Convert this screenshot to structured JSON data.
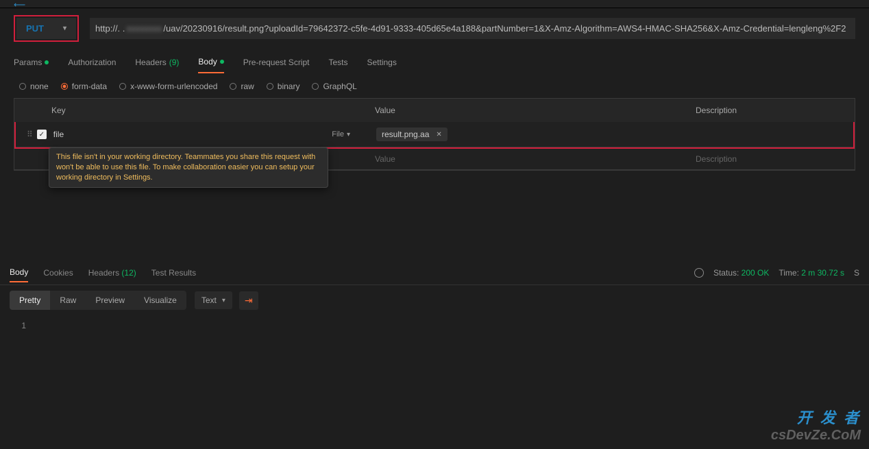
{
  "request": {
    "method": "PUT",
    "url_prefix": "http://. .",
    "url_blur": "xxxxxxxx",
    "url_rest": "/uav/20230916/result.png?uploadId=79642372-c5fe-4d91-9333-405d65e4a188&partNumber=1&X-Amz-Algorithm=AWS4-HMAC-SHA256&X-Amz-Credential=lengleng%2F2"
  },
  "tabs": {
    "params": "Params",
    "authorization": "Authorization",
    "headers": "Headers",
    "headers_count": "(9)",
    "body": "Body",
    "prerequest": "Pre-request Script",
    "tests": "Tests",
    "settings": "Settings"
  },
  "body_types": {
    "none": "none",
    "form": "form-data",
    "urlenc": "x-www-form-urlencoded",
    "raw": "raw",
    "binary": "binary",
    "graphql": "GraphQL"
  },
  "table": {
    "hkey": "Key",
    "hval": "Value",
    "hdesc": "Description",
    "row1_key": "file",
    "row1_type": "File",
    "row1_val": "result.png.aa",
    "placeholder_key": "Key",
    "placeholder_val": "Value",
    "placeholder_desc": "Description"
  },
  "warning": "This file isn't in your working directory. Teammates you share this request with won't be able to use this file. To make collaboration easier you can setup your working directory in Settings.",
  "response_tabs": {
    "body": "Body",
    "cookies": "Cookies",
    "headers": "Headers",
    "headers_count": "(12)",
    "test_results": "Test Results"
  },
  "status": {
    "label": "Status:",
    "code": "200 OK",
    "time_label": "Time:",
    "time_value": "2 m 30.72 s",
    "size_label": "S"
  },
  "view_tabs": {
    "pretty": "Pretty",
    "raw": "Raw",
    "preview": "Preview",
    "visualize": "Visualize",
    "format": "Text"
  },
  "editor": {
    "line1": "1"
  },
  "watermark": {
    "line1": "开 发 者",
    "line2": "csDevZe.CoM"
  }
}
